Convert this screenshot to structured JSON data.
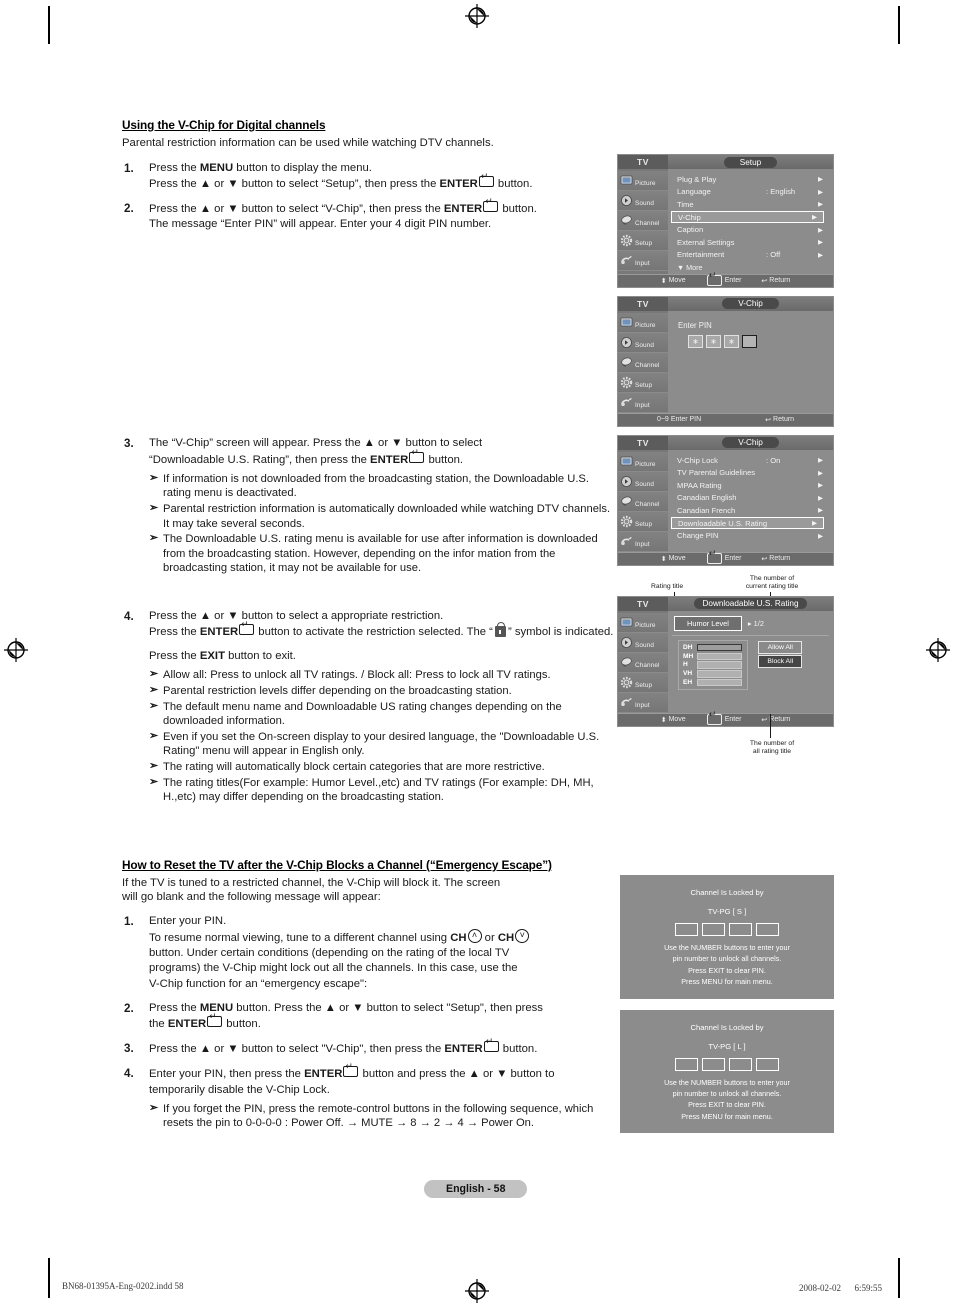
{
  "page": {
    "number_label": "English - 58",
    "footer_left": "BN68-01395A-Eng-0202.indd   58",
    "footer_right": "2008-02-02   　 6:59:55"
  },
  "section1": {
    "heading": "Using the V-Chip for Digital channels",
    "lead": "Parental restriction information can be used while watching DTV channels.",
    "steps": [
      {
        "num": "1.",
        "line1_a": "Press the ",
        "line1_b": "MENU",
        "line1_c": " button to display the menu.",
        "line2_a": "Press the ▲ or ▼ button to select “Setup”, then press the ",
        "line2_b": "ENTER",
        "line2_c": " button."
      },
      {
        "num": "2.",
        "line1_a": "Press the ▲ or ▼ button to select “V-Chip”, then press the ",
        "line1_b": "ENTER",
        "line1_c": " button.",
        "line2": "The message “Enter PIN” will appear. Enter your 4 digit PIN number."
      },
      {
        "num": "3.",
        "line1_a": "The “V-Chip” screen will appear. Press the ▲ or ▼ button to select",
        "line2_a": "“Downloadable U.S. Rating”, then press the ",
        "line2_b": "ENTER",
        "line2_c": " button.",
        "notes": [
          "If information is not downloaded from the broadcasting station, the Downloadable U.S. rating menu is deactivated.",
          "Parental restriction information is automatically downloaded while watching DTV channels. It may take several seconds.",
          "The Downloadable U.S. rating menu is available for use after information is downloaded from the broadcasting station. However, depending on the infor mation from the broadcasting station, it may not be available for use."
        ]
      },
      {
        "num": "4.",
        "line1": "Press the ▲ or ▼ button to select a appropriate restriction.",
        "line2_a": "Press the ",
        "line2_b": "ENTER",
        "line2_c": " button to activate the restriction selected. The “",
        "line2_d": "” symbol is indicated.",
        "line3_a": "Press the ",
        "line3_b": "EXIT",
        "line3_c": " button to exit.",
        "notes": [
          "Allow all: Press to unlock all TV ratings. / Block all: Press to lock all TV ratings.",
          "Parental restriction levels differ depending on the broadcasting station.",
          "The default menu name and Downloadable US rating changes depending on the downloaded information.",
          "Even if you set the On-screen display to your desired language, the \"Downloadable U.S. Rating\" menu will appear in English only.",
          "The rating will automatically block certain categories that are more restrictive.",
          "The rating titles(For example: Humor Level.,etc) and TV ratings (For example: DH, MH, H.,etc) may differ depending on the broadcasting station."
        ]
      }
    ]
  },
  "section2": {
    "heading": "How to Reset the TV after the V-Chip Blocks a Channel (“Emergency Escape”)",
    "lead_line1": "If the TV is tuned to a restricted channel, the V-Chip will block it. The screen",
    "lead_line2": "will go blank and the following message will appear:",
    "steps": [
      {
        "num": "1.",
        "line1": "Enter your PIN.",
        "line2_a": "To resume normal viewing, tune to a different channel using ",
        "line2_b": "CH",
        "line2_c": " or ",
        "line2_d": "CH",
        "line3": "button. Under certain conditions (depending on the rating of the local TV",
        "line4": "programs) the V-Chip might lock out all the channels. In this case, use the",
        "line5": "V-Chip function for an “emergency escape\":"
      },
      {
        "num": "2.",
        "line1_a": "Press the ",
        "line1_b": "MENU",
        "line1_c": " button. Press the ▲ or ▼ button to select \"Setup\", then press",
        "line2_a": "the ",
        "line2_b": "ENTER",
        "line2_c": " button."
      },
      {
        "num": "3.",
        "line1_a": "Press the ▲ or ▼ button to select \"V-Chip\", then press the ",
        "line1_b": "ENTER",
        "line1_c": " button."
      },
      {
        "num": "4.",
        "line1_a": "Enter your PIN, then press the ",
        "line1_b": "ENTER",
        "line1_c": " button and press the ▲ or ▼ button to",
        "line2": "temporarily disable the V-Chip Lock.",
        "notes": [
          "If you forget the PIN, press the remote-control buttons in the following sequence, which resets the pin to 0-0-0-0 : Power Off. → MUTE → 8 → 2 → 4 → Power On."
        ]
      }
    ]
  },
  "osd_common": {
    "tv_label": "TV",
    "sidebar": [
      {
        "label": "Picture",
        "icon": "picture-icon"
      },
      {
        "label": "Sound",
        "icon": "sound-icon"
      },
      {
        "label": "Channel",
        "icon": "channel-icon"
      },
      {
        "label": "Setup",
        "icon": "setup-icon"
      },
      {
        "label": "Input",
        "icon": "input-icon"
      }
    ],
    "footer_move": "Move",
    "footer_enter": "Enter",
    "footer_return": "Return"
  },
  "osd_setup": {
    "title": "Setup",
    "rows": [
      {
        "label": "Plug & Play",
        "value": "",
        "arrow": "▶",
        "selected": false
      },
      {
        "label": "Language",
        "value": ": English",
        "arrow": "▶",
        "selected": false
      },
      {
        "label": "Time",
        "value": "",
        "arrow": "▶",
        "selected": false
      },
      {
        "label": "V-Chip",
        "value": "",
        "arrow": "▶",
        "selected": true
      },
      {
        "label": "Caption",
        "value": "",
        "arrow": "▶",
        "selected": false
      },
      {
        "label": "External Settings",
        "value": "",
        "arrow": "▶",
        "selected": false
      },
      {
        "label": "Entertainment",
        "value": ": Off",
        "arrow": "▶",
        "selected": false
      },
      {
        "label": "▼ More",
        "value": "",
        "arrow": "",
        "selected": false
      }
    ]
  },
  "osd_pin": {
    "title": "V-Chip",
    "prompt": "Enter PIN",
    "digits": [
      "∗",
      "∗",
      "∗",
      ""
    ],
    "footer_enter_pin": "Enter PIN",
    "footer_enter_pin_keys": "0~9",
    "footer_return": "Return"
  },
  "osd_vchip": {
    "title": "V-Chip",
    "rows": [
      {
        "label": "V-Chip Lock",
        "value": ": On",
        "arrow": "▶",
        "selected": false
      },
      {
        "label": "TV Parental Guidelines",
        "value": "",
        "arrow": "▶",
        "selected": false
      },
      {
        "label": "MPAA Rating",
        "value": "",
        "arrow": "▶",
        "selected": false
      },
      {
        "label": "Canadian English",
        "value": "",
        "arrow": "▶",
        "selected": false
      },
      {
        "label": "Canadian French",
        "value": "",
        "arrow": "▶",
        "selected": false
      },
      {
        "label": "Downloadable U.S. Rating",
        "value": "",
        "arrow": "▶",
        "selected": true
      },
      {
        "label": "Change PIN",
        "value": "",
        "arrow": "▶",
        "selected": false
      }
    ]
  },
  "osd_downloadable": {
    "title": "Downloadable U.S. Rating",
    "rating_title": "Humor Level",
    "rating_count": "▸ 1/2",
    "rating_rows": [
      "DH",
      "MH",
      "H",
      "VH",
      "EH"
    ],
    "allow_all": "Allow All",
    "block_all": "Block All",
    "anno_rating_title": "Rating title",
    "anno_current_line1": "The number of",
    "anno_current_line2": "current rating title",
    "anno_all_line1": "The number of",
    "anno_all_line2": "all rating title"
  },
  "lock_messages": [
    {
      "line1": "Channel Is Locked by",
      "rating": "TV-PG [ S ]",
      "line3": "Use the NUMBER buttons to enter your",
      "line4": "pin number to unlock all channels.",
      "line5": "Press EXIT to clear PIN.",
      "line6": "Press MENU for main menu."
    },
    {
      "line1": "Channel Is Locked by",
      "rating": "TV-PG [ L ]",
      "line3": "Use the NUMBER buttons to enter your",
      "line4": "pin number to unlock all channels.",
      "line5": "Press EXIT to clear PIN.",
      "line6": "Press MENU for main menu."
    }
  ]
}
